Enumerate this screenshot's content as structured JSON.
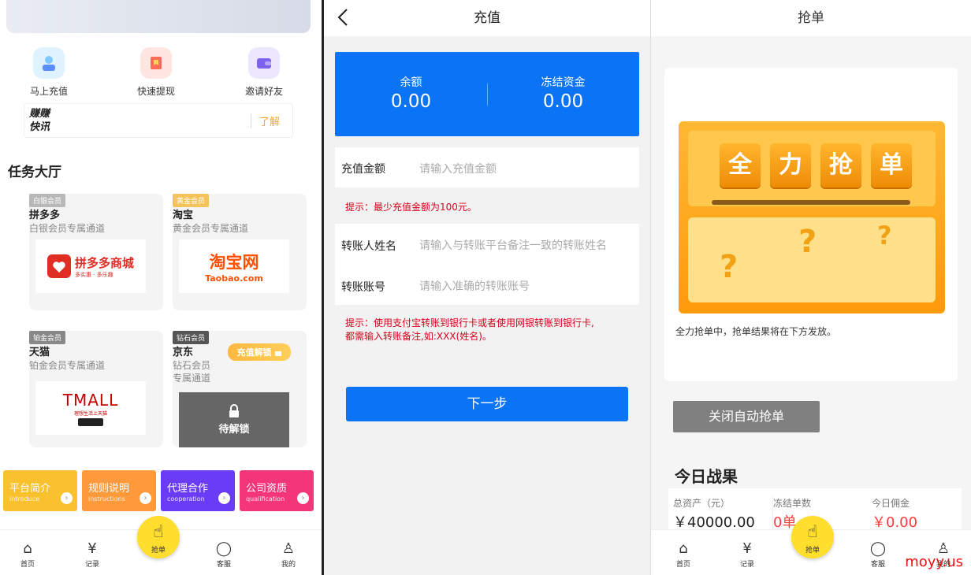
{
  "home": {
    "quick_actions": [
      {
        "label": "马上充值",
        "icon": "person-wallet-icon",
        "color": "#7fc7ff"
      },
      {
        "label": "快速提现",
        "icon": "bookmark-icon",
        "color": "#ff8a7a"
      },
      {
        "label": "邀请好友",
        "icon": "wallet-icon",
        "color": "#9b88ff"
      }
    ],
    "news": {
      "logo_line1": "赚赚",
      "logo_line2": "快讯",
      "learn": "了解"
    },
    "section_title": "任务大厅",
    "cards": [
      {
        "badge": "白银会员",
        "name": "拼多多",
        "sub": "白银会员专属通道",
        "brand": "拼多多商城",
        "brand_sub": "多实惠 · 多乐趣",
        "badge_color": "#b8b8b8"
      },
      {
        "badge": "黄金会员",
        "name": "淘宝",
        "sub": "黄金会员专属通道",
        "brand": "淘宝网",
        "brand_sub": "Taobao.com",
        "badge_color": "#f5c35c"
      },
      {
        "badge": "铂金会员",
        "name": "天猫",
        "sub": "铂金会员专属通道",
        "brand": "TMALL",
        "brand_sub": "理想生活上天猫",
        "badge_color": "#888888"
      },
      {
        "badge": "钻石会员",
        "name": "京东",
        "sub_line1": "钻石会员",
        "sub_line2": "专属通道",
        "unlock_btn": "充值解锁",
        "locked": "待解锁",
        "badge_color": "#555555"
      }
    ],
    "tiles": [
      {
        "title": "平台简介",
        "sub": "introduce",
        "color": "#f9c12e"
      },
      {
        "title": "规则说明",
        "sub": "instructions",
        "color": "#ff9a3c"
      },
      {
        "title": "代理合作",
        "sub": "cooperation",
        "color": "#6a3cf5"
      },
      {
        "title": "公司资质",
        "sub": "qualification",
        "color": "#f5357a"
      }
    ]
  },
  "tabs": {
    "home": "首页",
    "records": "记录",
    "grab": "抢单",
    "service": "客服",
    "mine": "我的"
  },
  "recharge": {
    "title": "充值",
    "balance_label": "余额",
    "balance_value": "0.00",
    "frozen_label": "冻结资金",
    "frozen_value": "0.00",
    "amount_label": "充值金额",
    "amount_placeholder": "请输入充值金额",
    "hint1": "提示：最少充值金额为100元。",
    "name_label": "转账人姓名",
    "name_placeholder": "请输入与转账平台备注一致的转账姓名",
    "account_label": "转账账号",
    "account_placeholder": "请输入准确的转账账号",
    "hint2_line1": "提示：使用支付宝转账到银行卡或者使用网银转账到银行卡,",
    "hint2_line2": "都需输入转账备注,如:XXX(姓名)。",
    "next": "下一步"
  },
  "grab": {
    "title": "抢单",
    "chars": [
      "全",
      "力",
      "抢",
      "单"
    ],
    "status": "全力抢单中，抢单结果将在下方发放。",
    "auto_btn": "关闭自动抢单",
    "today_title": "今日战果",
    "stats": [
      {
        "label": "总资产（元）",
        "value": "￥40000.00",
        "color": "#222222"
      },
      {
        "label": "冻结单数",
        "value": "0单",
        "color": "#ff3b3b"
      },
      {
        "label": "今日佣金",
        "value": "￥0.00",
        "color": "#ff3b3b"
      }
    ],
    "watermark": "moyy.us"
  }
}
